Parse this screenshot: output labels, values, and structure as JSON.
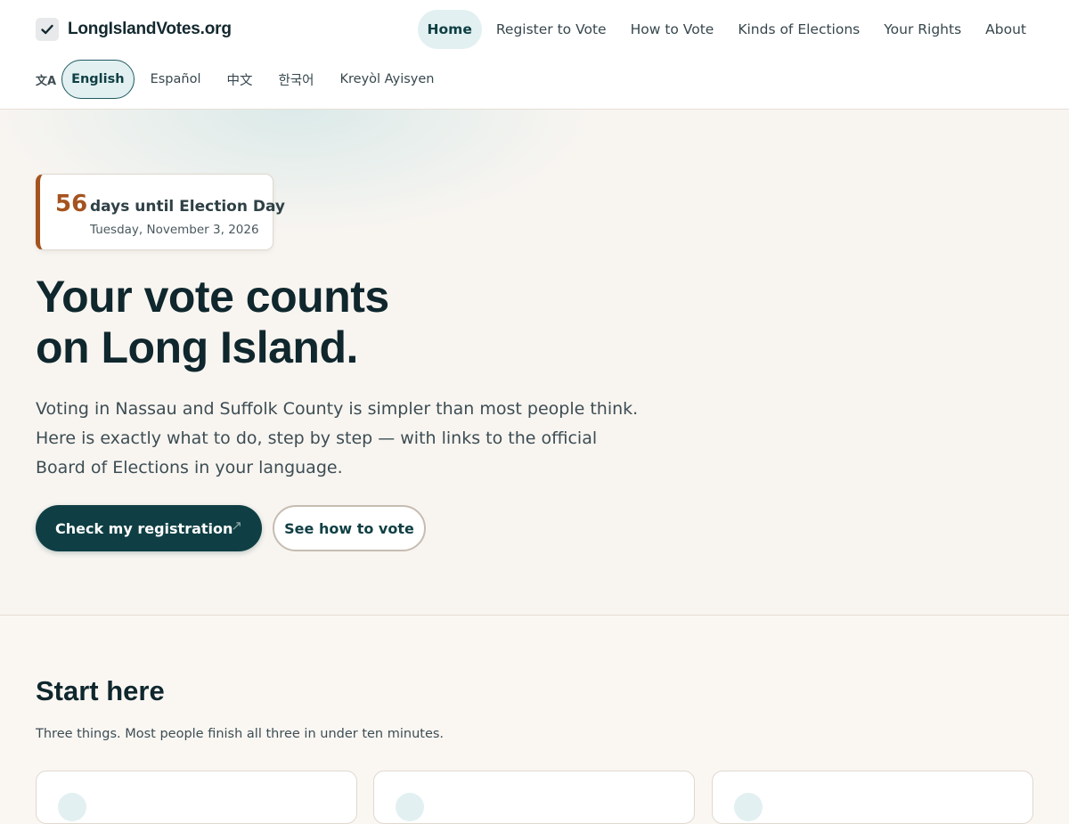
{
  "header": {
    "brand": "LongIslandVotes.org",
    "nav": [
      {
        "label": "Home",
        "active": true
      },
      {
        "label": "Register to Vote",
        "active": false
      },
      {
        "label": "How to Vote",
        "active": false
      },
      {
        "label": "Kinds of Elections",
        "active": false
      },
      {
        "label": "Your Rights",
        "active": false
      },
      {
        "label": "About",
        "active": false
      }
    ],
    "language_icon": "文A",
    "languages": [
      {
        "label": "English",
        "active": true
      },
      {
        "label": "Español",
        "active": false
      },
      {
        "label": "中文",
        "active": false
      },
      {
        "label": "한국어",
        "active": false
      },
      {
        "label": "Kreyòl Ayisyen",
        "active": false
      }
    ]
  },
  "hero": {
    "countdown": {
      "days": "56",
      "label": "days until Election Day",
      "date": "Tuesday, November 3, 2026"
    },
    "title_line1": "Your vote counts",
    "title_line2": "on Long Island.",
    "description": "Voting in Nassau and Suffolk County is simpler than most people think. Here is exactly what to do, step by step — with links to the official Board of Elections in your language.",
    "primary_button": "Check my registration",
    "primary_button_arrow": "↗",
    "secondary_button": "See how to vote"
  },
  "start_here": {
    "title": "Start here",
    "subtitle": "Three things. Most people finish all three in under ten minutes."
  },
  "colors": {
    "primary": "#0f3f44",
    "accent": "#a4531f",
    "active_bg": "#e2f0f1"
  }
}
